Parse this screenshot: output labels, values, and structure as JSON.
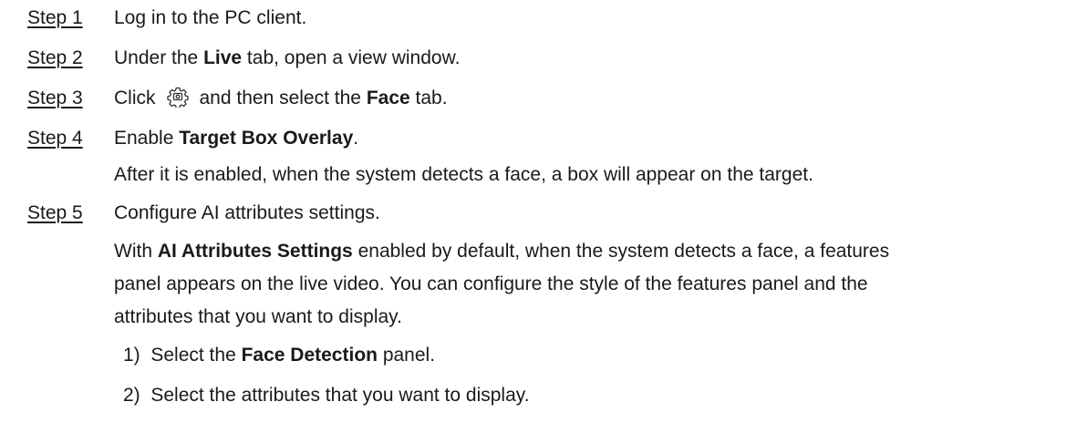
{
  "steps": [
    {
      "label": "Step 1",
      "text": "Log in to the PC client."
    },
    {
      "label": "Step 2",
      "pre": "Under the ",
      "bold": "Live",
      "post": " tab, open a view window."
    },
    {
      "label": "Step 3",
      "pre": "Click",
      "icon": "gear-settings-icon",
      "mid": "and then select the ",
      "bold": "Face",
      "post": " tab."
    },
    {
      "label": "Step 4",
      "pre": "Enable ",
      "bold": "Target Box Overlay",
      "post": ".",
      "note": "After it is enabled, when the system detects a face, a box will appear on the target."
    },
    {
      "label": "Step 5",
      "text": "Configure AI attributes settings.",
      "para_pre": "With ",
      "para_bold": "AI Attributes Settings",
      "para_line1_post": " enabled by default, when the system detects a face, a features",
      "para_line2": "panel appears on the live video. You can configure the style of the features panel and the",
      "para_line3": "attributes that you want to display.",
      "substeps": [
        {
          "num": "1)",
          "pre": "Select the ",
          "bold": "Face Detection",
          "post": " panel."
        },
        {
          "num": "2)",
          "text": "Select the attributes that you want to display."
        }
      ]
    }
  ]
}
